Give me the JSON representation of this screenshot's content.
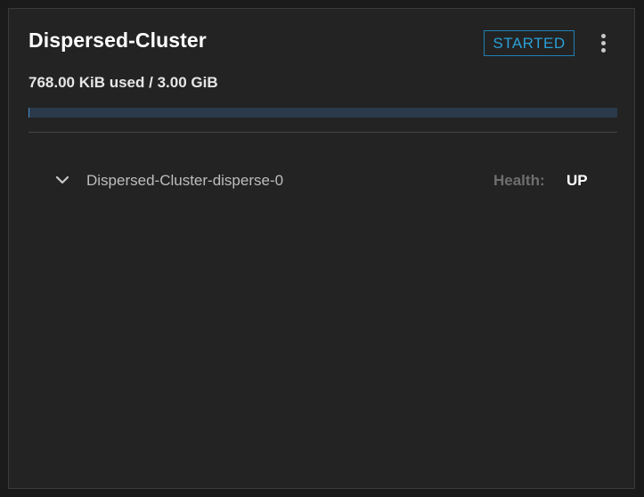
{
  "volume": {
    "name": "Dispersed-Cluster",
    "status": "STARTED",
    "usage_text": "768.00 KiB used / 3.00 GiB",
    "usage_fraction": 0.0002,
    "colors": {
      "status": "#2a9fd6",
      "bar_track": "#2a3a4c",
      "bar_fill": "#4a90c8"
    }
  },
  "menu": {
    "icon": "kebab-menu-icon"
  },
  "subvolumes": [
    {
      "name": "Dispersed-Cluster-disperse-0",
      "health_label": "Health:",
      "health_value": "UP",
      "icon": "chevron-down-icon"
    }
  ]
}
